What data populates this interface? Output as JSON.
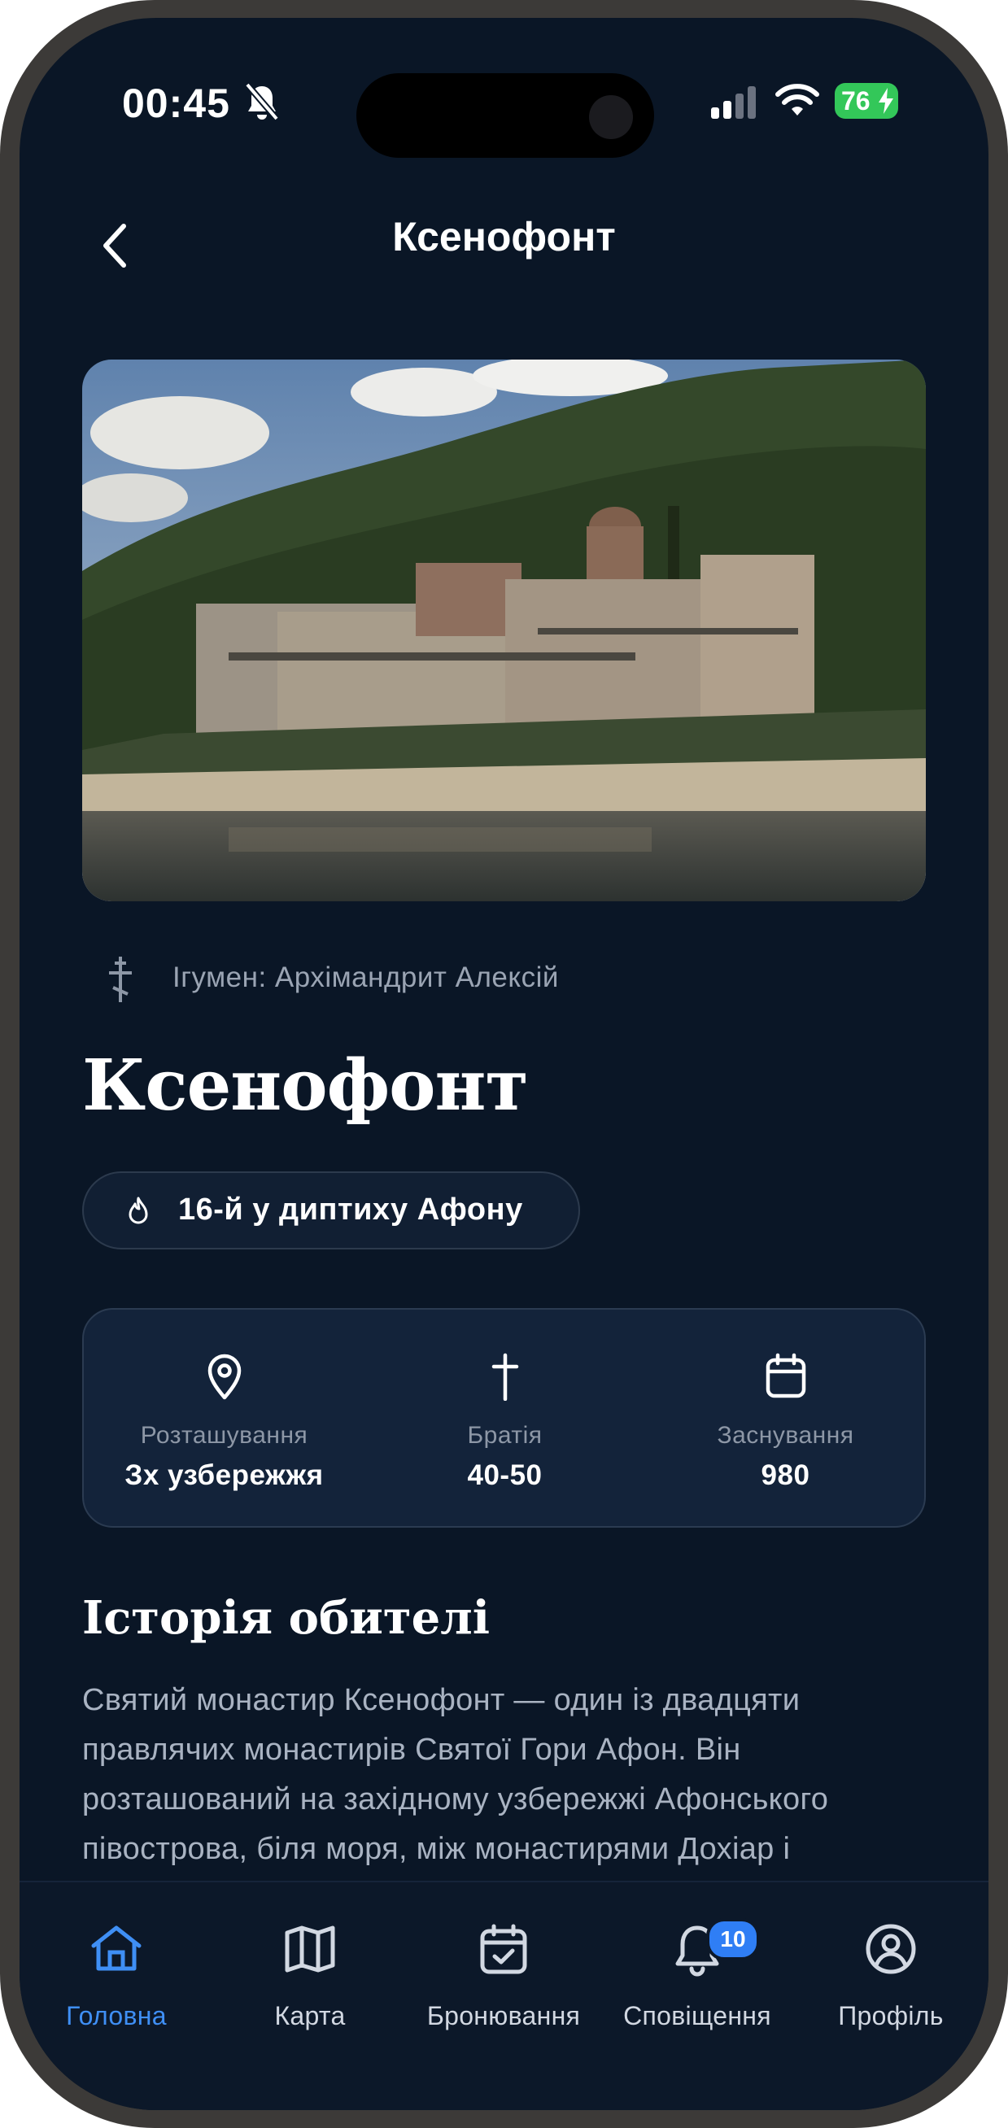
{
  "status_bar": {
    "time": "00:45",
    "battery": "76"
  },
  "header": {
    "title": "Ксенофонт"
  },
  "hero": {
    "alt": "Ксенофонт"
  },
  "abbot": {
    "text": "Ігумен: Архімандрит Алексій"
  },
  "monastery": {
    "name": "Ксенофонт",
    "diptych_badge": "16-й у диптиху Афону"
  },
  "stats": [
    {
      "icon": "location-pin-icon",
      "label": "Розташування",
      "value": "Зх узбережжя"
    },
    {
      "icon": "cross-icon",
      "label": "Братія",
      "value": "40-50"
    },
    {
      "icon": "calendar-icon",
      "label": "Заснування",
      "value": "980"
    }
  ],
  "history": {
    "title": "Історія обителі",
    "text": "Святий монастир Ксенофонт — один із двадцяти правлячих монастирів Святої Гори Афон. Він розташований на західному узбережжі Афонського півострова, біля моря, між монастирями Дохіар і"
  },
  "tabbar": {
    "active": "home",
    "items": [
      {
        "id": "home",
        "label": "Головна",
        "icon": "home-icon"
      },
      {
        "id": "map",
        "label": "Карта",
        "icon": "map-icon"
      },
      {
        "id": "booking",
        "label": "Бронювання",
        "icon": "calendar-check-icon"
      },
      {
        "id": "notifications",
        "label": "Сповіщення",
        "icon": "bell-icon",
        "badge": "10"
      },
      {
        "id": "profile",
        "label": "Профіль",
        "icon": "profile-icon"
      }
    ]
  },
  "colors": {
    "background": "#0a1626",
    "accent": "#3f8ff5",
    "card": "#13233a",
    "battery": "#33c759"
  }
}
